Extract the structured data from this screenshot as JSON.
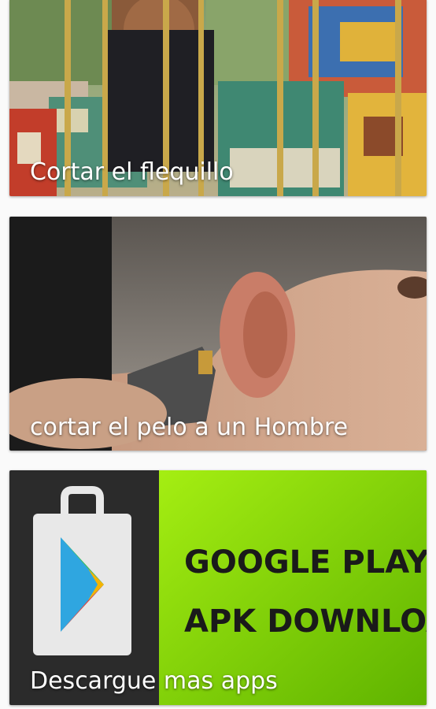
{
  "cards": [
    {
      "id": "cortar-flequillo",
      "title": "Cortar el flequillo",
      "image": "woman-on-amusement-ride-photo"
    },
    {
      "id": "cortar-pelo-hombre",
      "title": "cortar el pelo a un Hombre",
      "image": "man-haircut-clipper-photo"
    },
    {
      "id": "descargue-mas-apps",
      "title": "Descargue mas apps",
      "image": "google-playstore-banner",
      "banner_text": [
        "GOOGLE PLAYSTORE",
        "APK DOWNLOAD"
      ]
    }
  ],
  "colors": {
    "banner_green": "#7fd600",
    "banner_dark": "#2b2b2b",
    "title_text": "#ffffff"
  }
}
